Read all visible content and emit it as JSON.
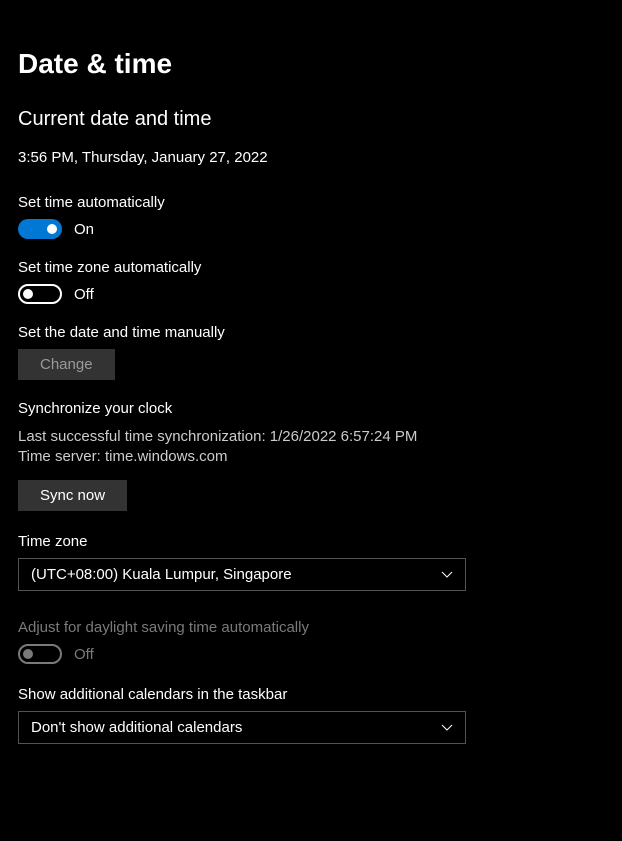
{
  "page": {
    "title": "Date & time"
  },
  "currentDateTime": {
    "sectionTitle": "Current date and time",
    "display": "3:56 PM, Thursday, January 27, 2022"
  },
  "setTimeAuto": {
    "label": "Set time automatically",
    "state": "On",
    "enabled": true
  },
  "setTimezoneAuto": {
    "label": "Set time zone automatically",
    "state": "Off",
    "enabled": false
  },
  "manualDateTime": {
    "label": "Set the date and time manually",
    "button": "Change"
  },
  "syncClock": {
    "title": "Synchronize your clock",
    "lastSync": "Last successful time synchronization: 1/26/2022 6:57:24 PM",
    "timeServer": "Time server: time.windows.com",
    "button": "Sync now"
  },
  "timezone": {
    "label": "Time zone",
    "selected": "(UTC+08:00) Kuala Lumpur, Singapore"
  },
  "dst": {
    "label": "Adjust for daylight saving time automatically",
    "state": "Off",
    "disabled": true
  },
  "additionalCalendars": {
    "label": "Show additional calendars in the taskbar",
    "selected": "Don't show additional calendars"
  }
}
